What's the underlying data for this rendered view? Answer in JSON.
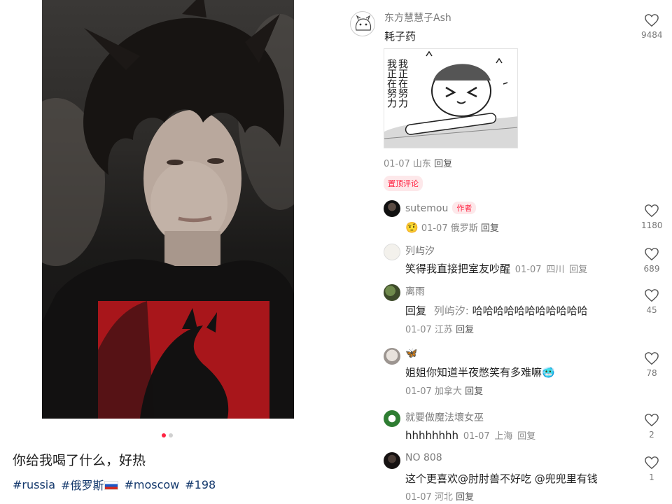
{
  "post": {
    "caption": "你给我喝了什么，好热",
    "tags": [
      "#russia",
      "#俄罗斯",
      "#moscow",
      "#198"
    ],
    "carousel": {
      "count": 2,
      "active": 1
    }
  },
  "comments": {
    "top": {
      "author": "东方慧慧子Ash",
      "text": "耗子药",
      "sticker_text_left": "我正在努力",
      "sticker_text_right": "我正在努力",
      "date": "01-07",
      "location": "山东",
      "reply_label": "回复",
      "pinned_label": "置顶评论",
      "likes": "9484"
    },
    "replies": [
      {
        "author": "sutemou",
        "badge": "作者",
        "emoji": "🤨",
        "date": "01-07",
        "location": "俄罗斯",
        "reply_label": "回复",
        "likes": "1180"
      },
      {
        "author": "列屿汐",
        "text": "笑得我直接把室友吵醒",
        "date": "01-07",
        "location": "四川",
        "reply_label": "回复",
        "likes": "689"
      },
      {
        "author": "离雨",
        "reply_prefix": "回复",
        "reply_to": "列屿汐:",
        "text": "哈哈哈哈哈哈哈哈哈哈哈",
        "date": "01-07",
        "location": "江苏",
        "reply_label": "回复",
        "likes": "45"
      },
      {
        "author": "🦋",
        "text": "姐姐你知道半夜憋笑有多难嘛🥶",
        "date": "01-07",
        "location": "加拿大",
        "reply_label": "回复",
        "likes": "78"
      },
      {
        "author": "就要做魔法壞女巫",
        "text": "hhhhhhhh",
        "date": "01-07",
        "location": "上海",
        "reply_label": "回复",
        "likes": "2"
      },
      {
        "author": "NO 808",
        "text": "这个更喜欢@肘肘兽不好吃 @兜兜里有钱",
        "date": "01-07",
        "location": "河北",
        "reply_label": "回复",
        "likes": "1"
      }
    ]
  },
  "colors": {
    "accent": "#ff2442",
    "tag": "#13386c",
    "muted": "#8a8a8a"
  }
}
